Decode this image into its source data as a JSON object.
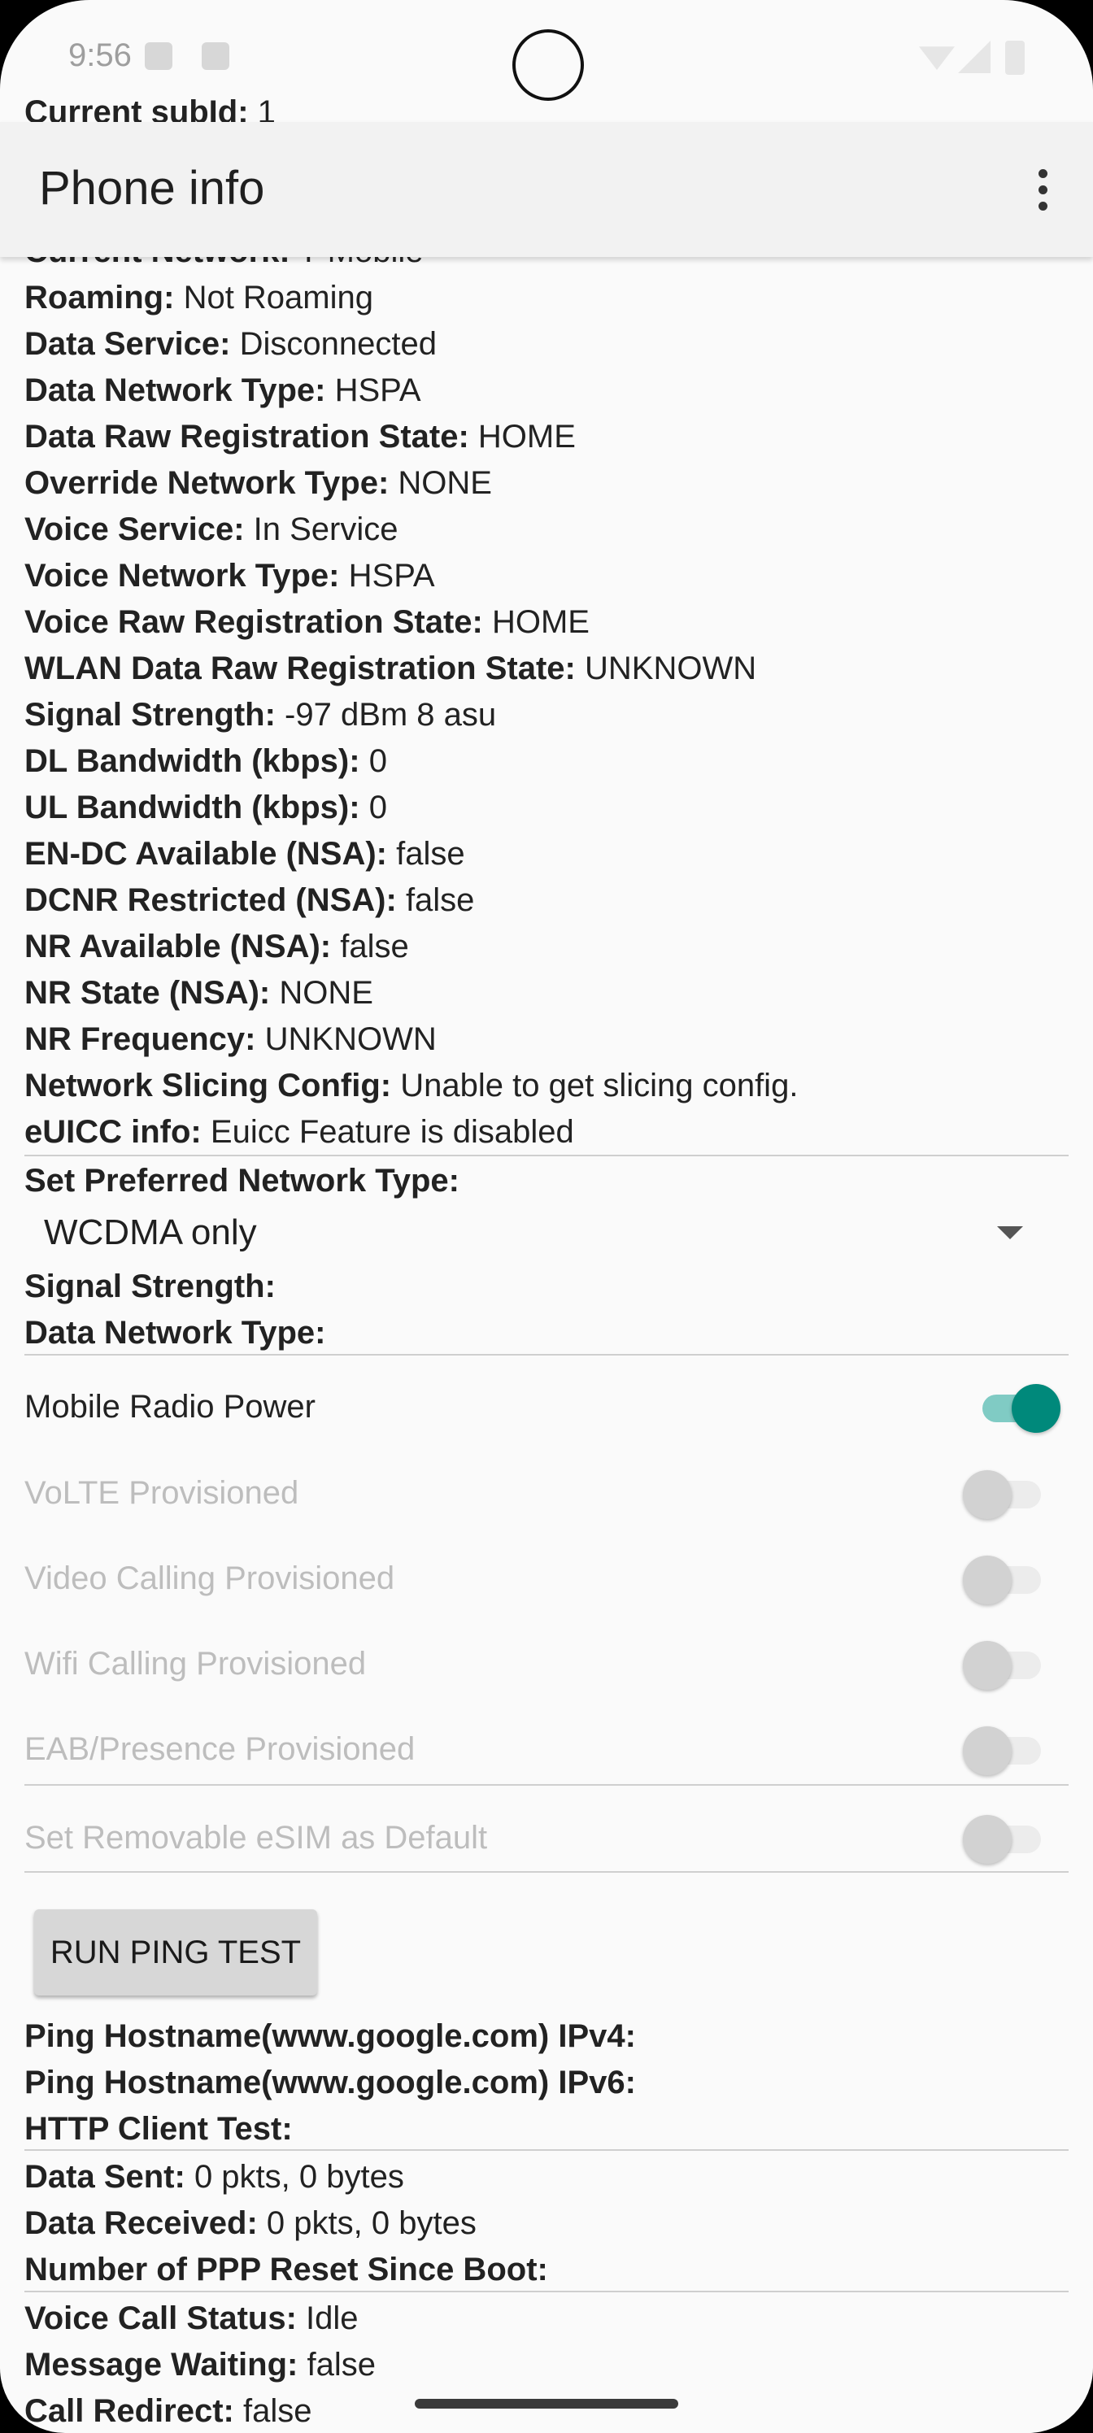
{
  "status_bar": {
    "time": "9:56"
  },
  "app_bar": {
    "title": "Phone info",
    "overflow_icon": "more-vert-icon"
  },
  "top_partial": {
    "key": "Current subId:",
    "value": "1"
  },
  "hidden_partial": {
    "key": "Current Network:",
    "value": "T-Mobile"
  },
  "info_rows": [
    {
      "key": "Roaming:",
      "value": "Not Roaming"
    },
    {
      "key": "Data Service:",
      "value": "Disconnected"
    },
    {
      "key": "Data Network Type:",
      "value": "HSPA"
    },
    {
      "key": "Data Raw Registration State:",
      "value": "HOME"
    },
    {
      "key": "Override Network Type:",
      "value": "NONE"
    },
    {
      "key": "Voice Service:",
      "value": "In Service"
    },
    {
      "key": "Voice Network Type:",
      "value": "HSPA"
    },
    {
      "key": "Voice Raw Registration State:",
      "value": "HOME"
    },
    {
      "key": "WLAN Data Raw Registration State:",
      "value": "UNKNOWN"
    },
    {
      "key": "Signal Strength:",
      "value": "-97 dBm   8 asu"
    },
    {
      "key": "DL Bandwidth (kbps):",
      "value": "0"
    },
    {
      "key": "UL Bandwidth (kbps):",
      "value": "0"
    },
    {
      "key": "EN-DC Available (NSA):",
      "value": "false"
    },
    {
      "key": "DCNR Restricted (NSA):",
      "value": "false"
    },
    {
      "key": "NR Available (NSA):",
      "value": "false"
    },
    {
      "key": "NR State (NSA):",
      "value": "NONE"
    },
    {
      "key": "NR Frequency:",
      "value": "UNKNOWN"
    },
    {
      "key": "Network Slicing Config:",
      "value": "Unable to get slicing config."
    },
    {
      "key": "eUICC info:",
      "value": "Euicc Feature is disabled"
    }
  ],
  "preferred_network": {
    "label": "Set Preferred Network Type:",
    "selected": "WCDMA only",
    "signal_strength_label": "Signal Strength:",
    "data_network_type_label": "Data Network Type:"
  },
  "switches": [
    {
      "label": "Mobile Radio Power",
      "on": true,
      "enabled": true
    },
    {
      "label": "VoLTE Provisioned",
      "on": false,
      "enabled": false
    },
    {
      "label": "Video Calling Provisioned",
      "on": false,
      "enabled": false
    },
    {
      "label": "Wifi Calling Provisioned",
      "on": false,
      "enabled": false
    },
    {
      "label": "EAB/Presence Provisioned",
      "on": false,
      "enabled": false
    },
    {
      "label": "Set Removable eSIM as Default",
      "on": false,
      "enabled": false
    }
  ],
  "ping": {
    "button_label": "RUN PING TEST",
    "ipv4_label": "Ping Hostname(www.google.com) IPv4:",
    "ipv6_label": "Ping Hostname(www.google.com) IPv6:",
    "http_label": "HTTP Client Test:"
  },
  "traffic_rows": [
    {
      "key": "Data Sent:",
      "value": "0 pkts, 0 bytes"
    },
    {
      "key": "Data Received:",
      "value": "0 pkts, 0 bytes"
    },
    {
      "key": "Number of PPP Reset Since Boot:",
      "value": ""
    }
  ],
  "call_rows": [
    {
      "key": "Voice Call Status:",
      "value": "Idle"
    },
    {
      "key": "Message Waiting:",
      "value": "false"
    },
    {
      "key": "Call Redirect:",
      "value": "false"
    }
  ],
  "colors": {
    "switch_on_thumb": "#00897b",
    "switch_on_track": "#80cbc4",
    "switch_off_thumb": "#d2d2d2",
    "switch_off_track": "#ececec"
  }
}
